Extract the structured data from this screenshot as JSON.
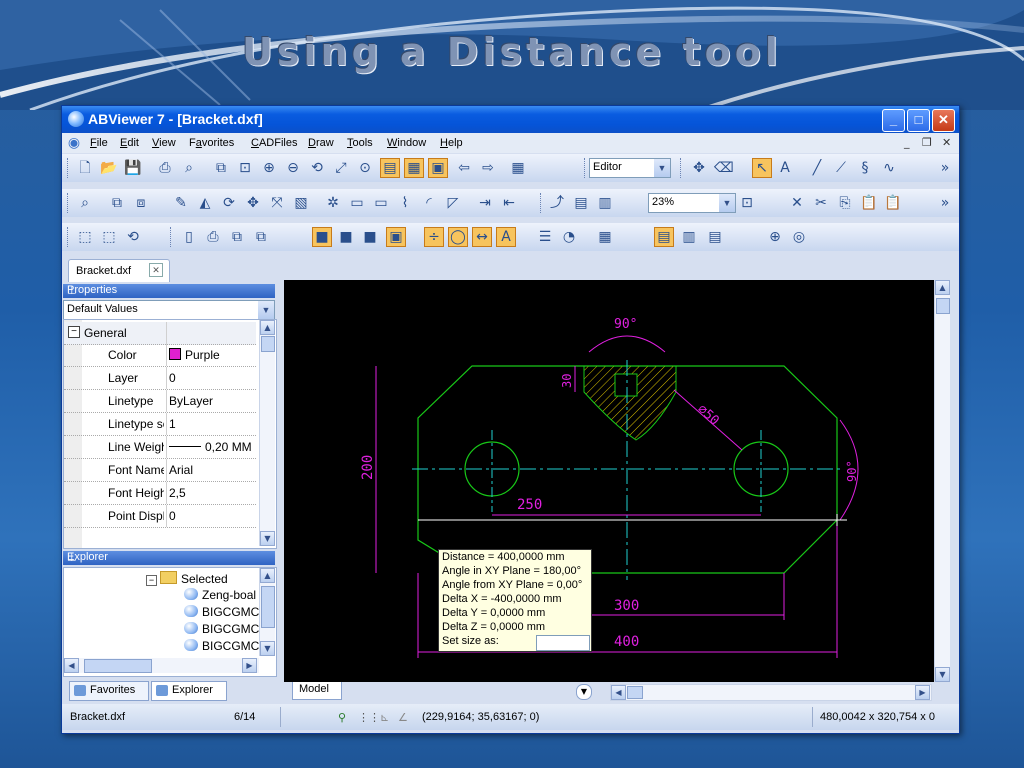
{
  "slide": {
    "title": "Using a Distance tool"
  },
  "window": {
    "title": "ABViewer 7 - [Bracket.dxf]"
  },
  "menu": [
    "File",
    "Edit",
    "View",
    "Favorites",
    "CADFiles",
    "Draw",
    "Tools",
    "Window",
    "Help"
  ],
  "menu_accel": [
    "F",
    "E",
    "V",
    "a",
    "C",
    "D",
    "T",
    "W",
    "H"
  ],
  "toolbar": {
    "mode_select": "Editor",
    "zoom_select": "23%"
  },
  "doc_tab": {
    "label": "Bracket.dxf"
  },
  "properties": {
    "header": "Properties",
    "dropdown": "Default Values",
    "group": "General",
    "rows": [
      {
        "key": "Color",
        "value": "Purple"
      },
      {
        "key": "Layer",
        "value": "0"
      },
      {
        "key": "Linetype",
        "value": "ByLayer"
      },
      {
        "key": "Linetype sc",
        "value": "1"
      },
      {
        "key": "Line Weigh",
        "value": "0,20 MM"
      },
      {
        "key": "Font Name",
        "value": "Arial"
      },
      {
        "key": "Font Heigh",
        "value": "2,5"
      },
      {
        "key": "Point Displ",
        "value": "0"
      }
    ],
    "color_swatch": "#e020d0"
  },
  "explorer": {
    "header": "Explorer",
    "items": [
      "Selected",
      "Zeng-boal",
      "BIGCGMC",
      "BIGCGMC",
      "BIGCGMC"
    ],
    "tabs": [
      "Favorites",
      "Explorer"
    ]
  },
  "drawing": {
    "dims": {
      "angle_top": "90°",
      "diameter": "⌀50",
      "angle_right": "90°",
      "height": "200",
      "depth": "30",
      "w250": "250",
      "w300": "300",
      "w400": "400"
    },
    "colors": {
      "outline": "#18c818",
      "center": "#20d0d0",
      "dim": "#e020e0",
      "hatch": "#d8c000",
      "measure": "#ffffff"
    }
  },
  "tooltip": {
    "lines": [
      "Distance = 400,0000 mm",
      "Angle in XY Plane = 180,00°",
      "Angle from XY Plane = 0,00°",
      "Delta X = -400,0000 mm",
      "Delta Y = 0,0000 mm",
      "Delta Z = 0,0000 mm",
      "Set size as:"
    ]
  },
  "model_tab": "Model",
  "status": {
    "file": "Bracket.dxf",
    "page": "6/14",
    "coords": "(229,9164; 35,63167; 0)",
    "size": "480,0042 x 320,754 x 0"
  }
}
